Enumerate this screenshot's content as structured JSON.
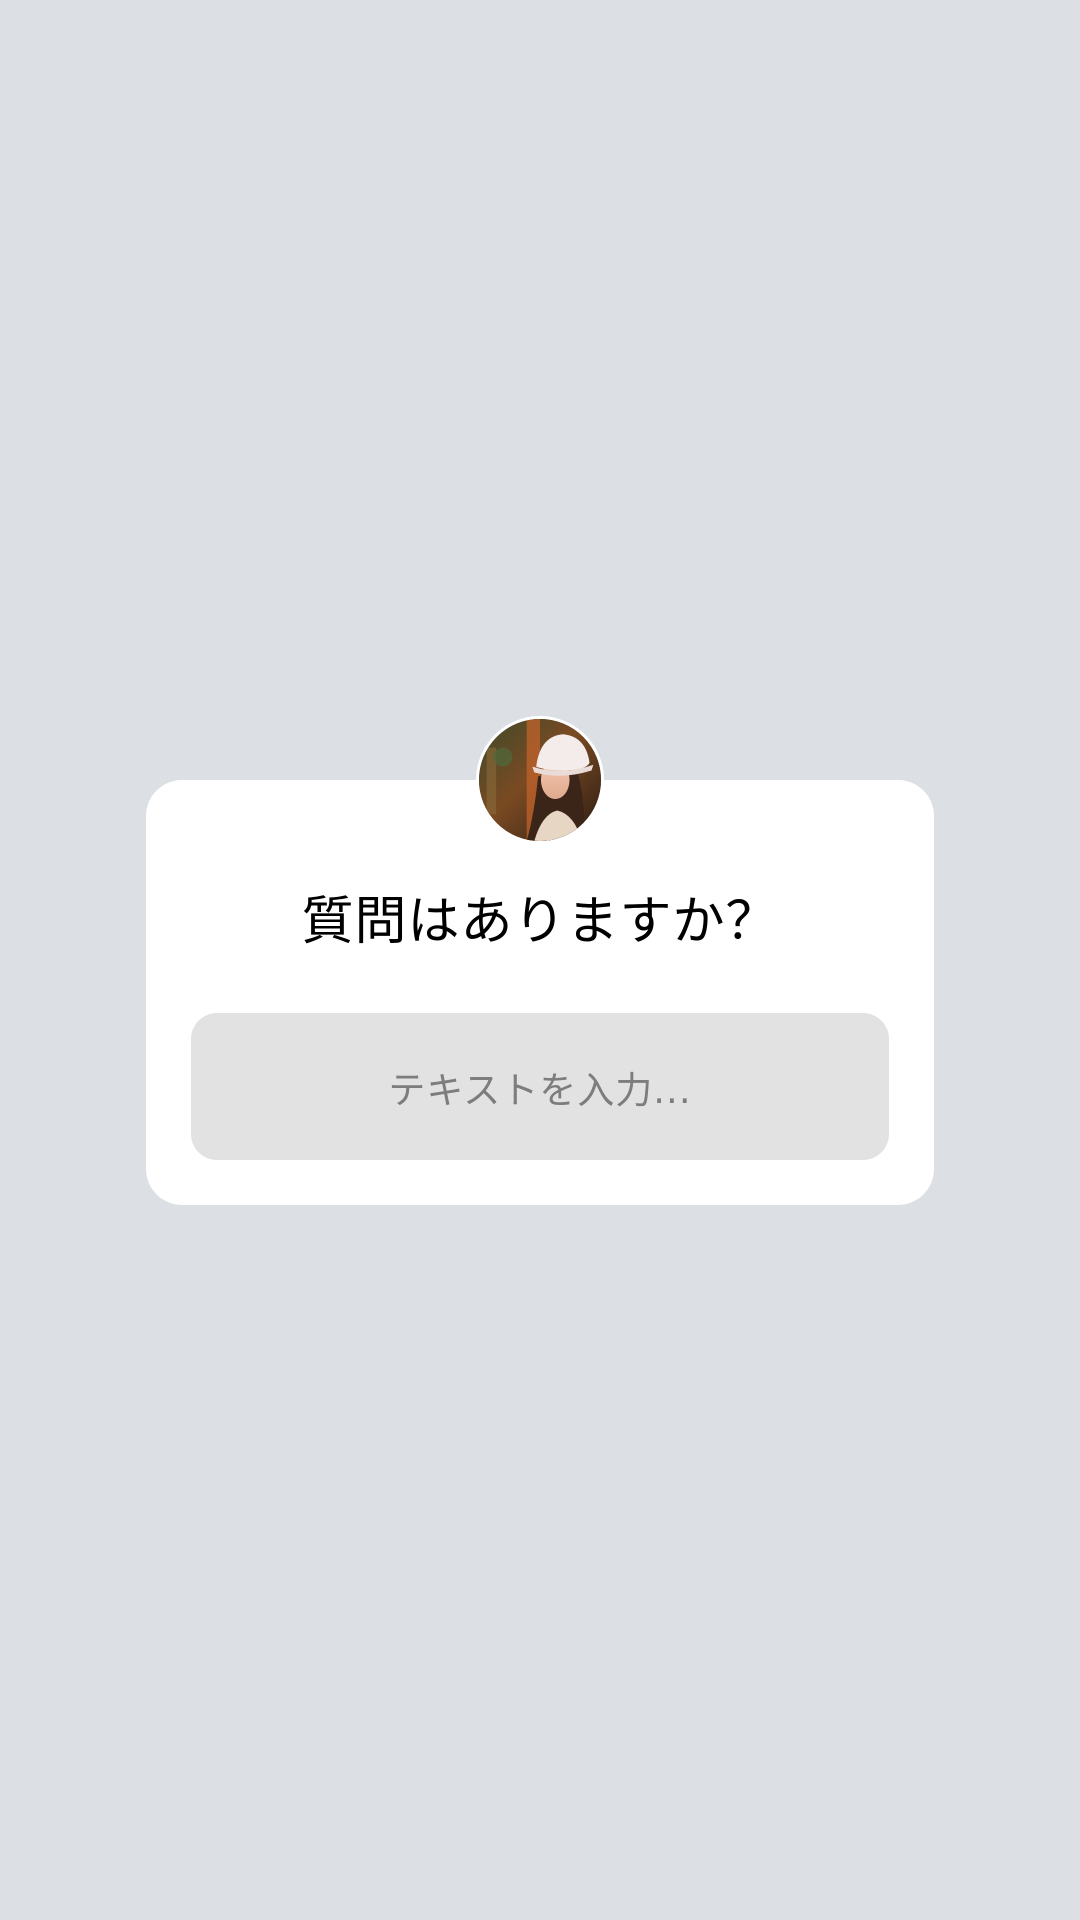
{
  "question_sticker": {
    "title": "質問はありますか？",
    "input_placeholder": "テキストを入力..."
  },
  "avatar": {
    "icon": "profile-photo-woman-in-white-bucket-hat"
  },
  "colors": {
    "background": "#dcdfe3",
    "card": "#ffffff",
    "input": "#e2e2e2",
    "placeholder_text": "#7d7d7d",
    "title_text": "#000000"
  }
}
